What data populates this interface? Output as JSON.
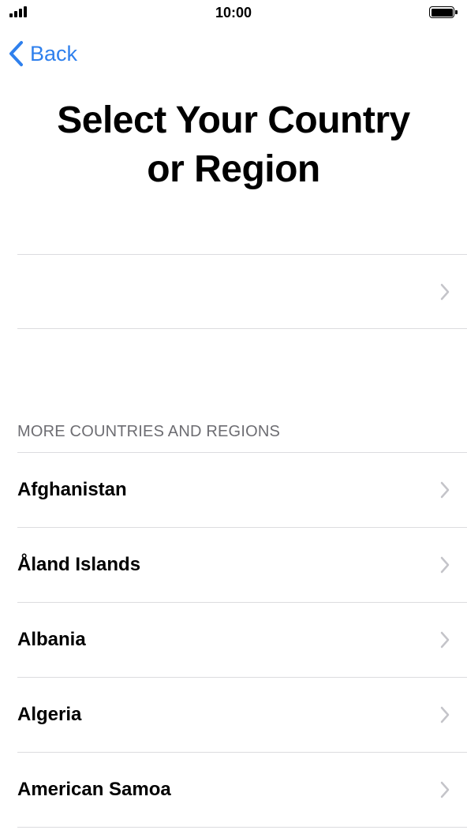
{
  "status_bar": {
    "time": "10:00",
    "signal_bars": 4,
    "battery_level": 1.0
  },
  "nav": {
    "back_label": "Back",
    "accent_color": "#2f80ed"
  },
  "title": {
    "line1": "Select Your Country",
    "line2": "or Region"
  },
  "suggested": {
    "label": ""
  },
  "more_section": {
    "header": "MORE COUNTRIES AND REGIONS",
    "countries": [
      {
        "name": "Afghanistan"
      },
      {
        "name": "Åland Islands"
      },
      {
        "name": "Albania"
      },
      {
        "name": "Algeria"
      },
      {
        "name": "American Samoa"
      }
    ]
  },
  "icons": {
    "back": "chevron-left-icon",
    "row_disclosure": "chevron-right-icon",
    "signal": "cellular-signal-icon",
    "battery": "battery-icon"
  }
}
